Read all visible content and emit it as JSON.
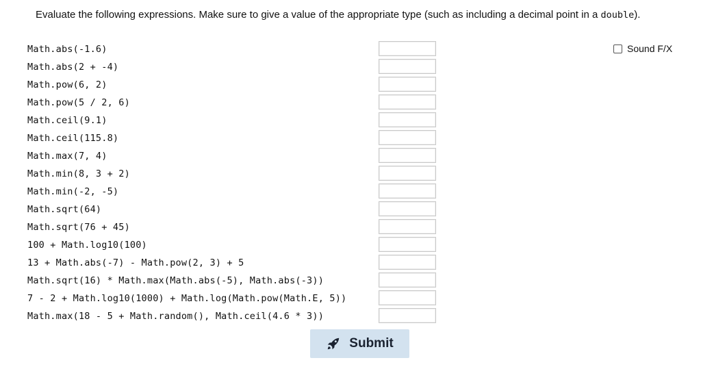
{
  "instructions": {
    "before_code": "Evaluate the following expressions. Make sure to give a value of the appropriate type (such as including a decimal point in a ",
    "code": "double",
    "after_code": ")."
  },
  "sound": {
    "label": "Sound F/X",
    "checked": false
  },
  "expressions": [
    "Math.abs(-1.6)",
    "Math.abs(2 + -4)",
    "Math.pow(6, 2)",
    "Math.pow(5 / 2, 6)",
    "Math.ceil(9.1)",
    "Math.ceil(115.8)",
    "Math.max(7, 4)",
    "Math.min(8, 3 + 2)",
    "Math.min(-2, -5)",
    "Math.sqrt(64)",
    "Math.sqrt(76 + 45)",
    "100 + Math.log10(100)",
    "13 + Math.abs(-7) - Math.pow(2, 3) + 5",
    "Math.sqrt(16) * Math.max(Math.abs(-5), Math.abs(-3))",
    "7 - 2 + Math.log10(1000) + Math.log(Math.pow(Math.E, 5))",
    "Math.max(18 - 5 + Math.random(), Math.ceil(4.6 * 3))"
  ],
  "answers": [
    "",
    "",
    "",
    "",
    "",
    "",
    "",
    "",
    "",
    "",
    "",
    "",
    "",
    "",
    "",
    ""
  ],
  "submit": {
    "label": "Submit",
    "icon": "rocket-icon"
  }
}
